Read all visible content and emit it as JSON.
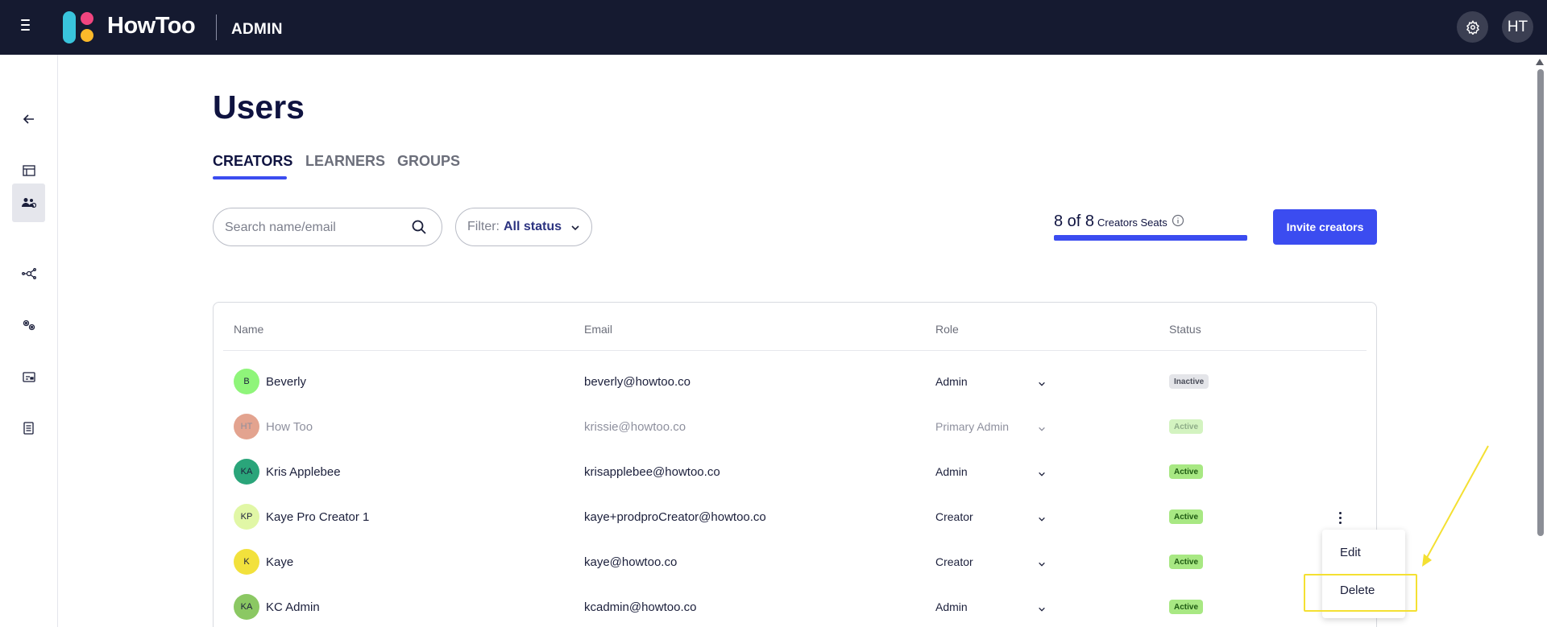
{
  "header": {
    "brand": "HowToo",
    "section": "ADMIN",
    "user_initials": "HT"
  },
  "sidebar": {
    "items": [
      {
        "name": "back",
        "icon": "arrow-left-icon"
      },
      {
        "name": "content",
        "icon": "layout-icon"
      },
      {
        "name": "users",
        "icon": "users-icon",
        "active": true
      },
      {
        "name": "integrations",
        "icon": "network-icon"
      },
      {
        "name": "settings",
        "icon": "cogs-icon"
      },
      {
        "name": "billing",
        "icon": "card-icon"
      },
      {
        "name": "reports",
        "icon": "document-icon"
      }
    ]
  },
  "page": {
    "title": "Users"
  },
  "tabs": [
    {
      "label": "CREATORS",
      "active": true
    },
    {
      "label": "LEARNERS",
      "active": false
    },
    {
      "label": "GROUPS",
      "active": false
    }
  ],
  "search": {
    "placeholder": "Search name/email",
    "value": ""
  },
  "filter": {
    "label": "Filter:",
    "value": "All status"
  },
  "seats": {
    "count": "8 of 8",
    "label": "Creators Seats",
    "used": 8,
    "total": 8
  },
  "invite_button": "Invite creators",
  "table": {
    "columns": [
      "Name",
      "Email",
      "Role",
      "Status"
    ],
    "rows": [
      {
        "initials": "B",
        "name": "Beverly",
        "email": "beverly@howtoo.co",
        "role": "Admin",
        "status": "Inactive",
        "avatar_color": "#8ff57a",
        "muted": false
      },
      {
        "initials": "HT",
        "name": "How Too",
        "email": "krissie@howtoo.co",
        "role": "Primary Admin",
        "status": "Active",
        "avatar_color": "#c94a22",
        "muted": true
      },
      {
        "initials": "KA",
        "name": "Kris Applebee",
        "email": "krisapplebee@howtoo.co",
        "role": "Admin",
        "status": "Active",
        "avatar_color": "#2aa57a",
        "muted": false
      },
      {
        "initials": "KP",
        "name": "Kaye Pro Creator 1",
        "email": "kaye+prodproCreator@howtoo.co",
        "role": "Creator",
        "status": "Active",
        "avatar_color": "#e1f7a6",
        "muted": false
      },
      {
        "initials": "K",
        "name": "Kaye",
        "email": "kaye@howtoo.co",
        "role": "Creator",
        "status": "Active",
        "avatar_color": "#f2e13c",
        "muted": false
      },
      {
        "initials": "KA",
        "name": "KC Admin",
        "email": "kcadmin@howtoo.co",
        "role": "Admin",
        "status": "Active",
        "avatar_color": "#8bc863",
        "muted": false
      }
    ]
  },
  "context_menu": {
    "items": [
      "Edit",
      "Delete"
    ]
  },
  "colors": {
    "topbar": "#151a30",
    "accent": "#3b4cf0",
    "active_badge": "#a8e883",
    "highlight": "#f4e032"
  }
}
